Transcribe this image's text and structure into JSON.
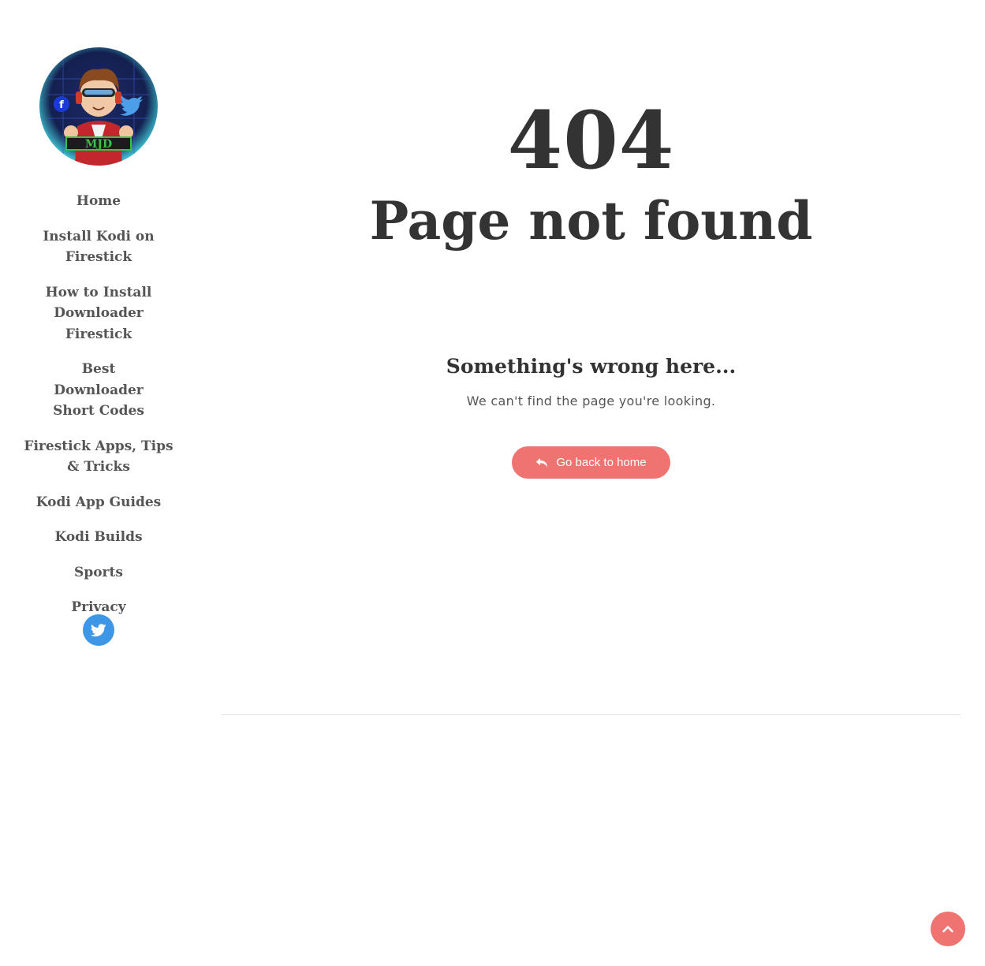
{
  "sidebar": {
    "logo_text": "MJD",
    "nav": [
      {
        "label": "Home"
      },
      {
        "label": "Install Kodi on Firestick"
      },
      {
        "label": "How to Install Downloader Firestick"
      },
      {
        "label": "Best Downloader Short Codes"
      },
      {
        "label": "Firestick Apps, Tips & Tricks"
      },
      {
        "label": "Kodi App Guides"
      },
      {
        "label": "Kodi Builds"
      },
      {
        "label": "Sports"
      },
      {
        "label": "Privacy"
      }
    ],
    "social": [
      {
        "icon": "twitter-icon",
        "color": "#3e97e6"
      }
    ]
  },
  "main": {
    "error_code": "404",
    "error_title": "Page not found",
    "subtitle": "Something's wrong here...",
    "message": "We can't find the page you're looking.",
    "home_button": {
      "label": "Go back to home",
      "icon": "reply-icon",
      "color": "#ef7371"
    }
  },
  "back_to_top": {
    "icon": "chevron-up-icon",
    "color": "#ef7371"
  }
}
